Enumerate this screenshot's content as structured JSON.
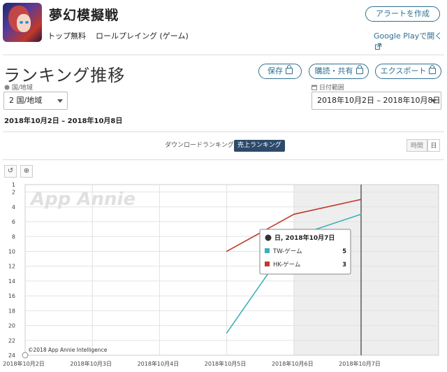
{
  "app": {
    "title": "夢幻模擬戦",
    "publisher": "トップ無料",
    "genre": "ロールプレイング (ゲーム)",
    "alert_button": "アラートを作成",
    "gplay_link": "Google Playで開く"
  },
  "section": {
    "title": "ランキング推移",
    "save_button": "保存",
    "subscribe_button": "購読・共有",
    "export_button": "エクスポート"
  },
  "filters": {
    "country_label": "国/地域",
    "country_value": "2 国/地域",
    "date_label": "日付範囲",
    "date_value": "2018年10月2日 – 2018年10月8日",
    "range_text": "2018年10月2日 – 2018年10月8日"
  },
  "tabs": {
    "download": "ダウンロードランキング",
    "sales": "売上ランキング"
  },
  "granularity": {
    "hour": "時間",
    "day": "日"
  },
  "tools": {
    "reset": "↺",
    "zoom": "⊕"
  },
  "chart_data": {
    "type": "line",
    "watermark": "App Annie",
    "copyright": "©2018 App Annie Intelligence",
    "x": [
      "2018年10月2日",
      "2018年10月3日",
      "2018年10月4日",
      "2018年10月5日",
      "2018年10月6日",
      "2018年10月7日"
    ],
    "ylim": [
      24,
      1
    ],
    "y_ticks": [
      1,
      2,
      4,
      6,
      8,
      10,
      12,
      14,
      16,
      18,
      20,
      22,
      24
    ],
    "y_inverted": true,
    "grid": true,
    "shaded_from": "2018年10月6日",
    "series": [
      {
        "name": "TW-ゲーム",
        "color": "#3bb0b8",
        "values": [
          null,
          null,
          null,
          21,
          8,
          5
        ]
      },
      {
        "name": "HK-ゲーム",
        "color": "#c0392b",
        "values": [
          null,
          null,
          null,
          10,
          5,
          3
        ]
      }
    ],
    "tooltip": {
      "title": "日, 2018年10月7日",
      "rows": [
        {
          "name": "TW-ゲーム",
          "value": "5"
        },
        {
          "name": "HK-ゲーム",
          "value": "3"
        }
      ]
    }
  }
}
